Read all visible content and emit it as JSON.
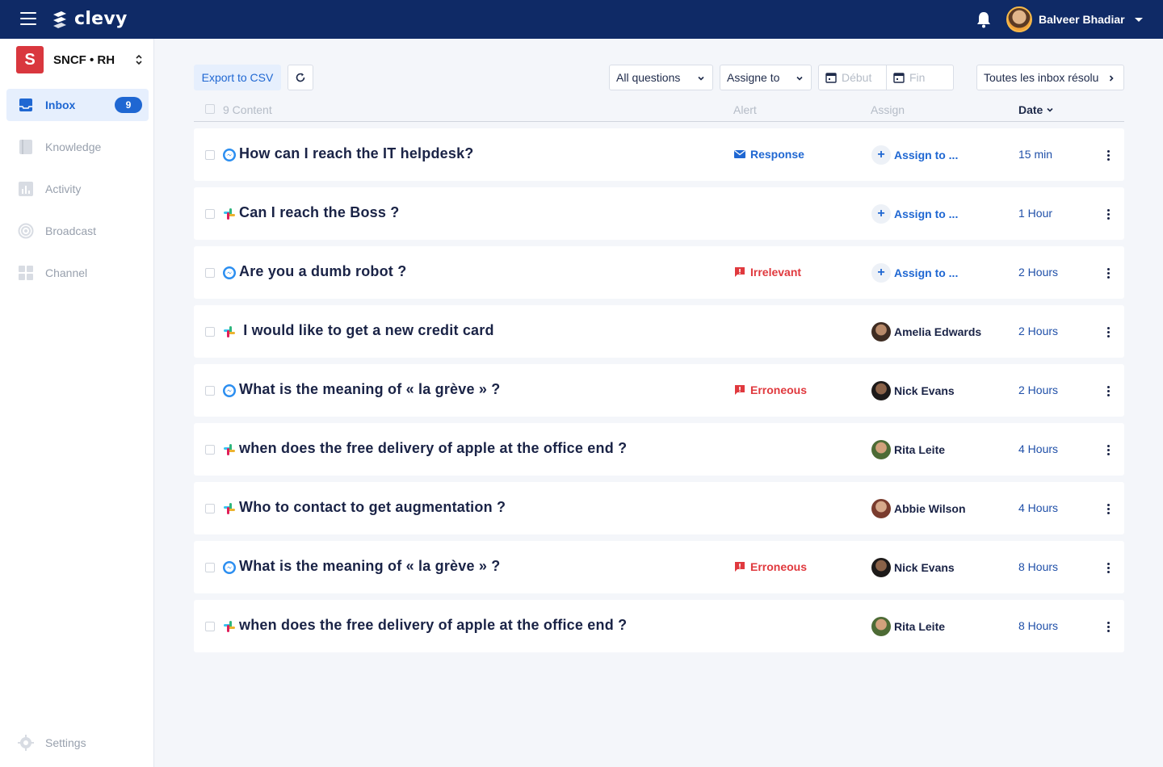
{
  "topbar": {
    "logo_text": "clevy",
    "user_name": "Balveer Bhadiar"
  },
  "sidebar": {
    "org_initial": "S",
    "org_name": "SNCF • RH",
    "items": [
      {
        "label": "Inbox",
        "icon": "inbox-icon",
        "badge": "9",
        "active": true
      },
      {
        "label": "Knowledge",
        "icon": "book-icon"
      },
      {
        "label": "Activity",
        "icon": "bar-chart-icon"
      },
      {
        "label": "Broadcast",
        "icon": "broadcast-icon"
      },
      {
        "label": "Channel",
        "icon": "grid-icon"
      }
    ],
    "settings_label": "Settings"
  },
  "toolbar": {
    "export_label": "Export to CSV",
    "questions_filter": "All questions",
    "assignee_filter": "Assigne to",
    "start_placeholder": "Début",
    "end_placeholder": "Fin",
    "inbox_filter": "Toutes les inbox résolu"
  },
  "header": {
    "content": "9 Content",
    "alert": "Alert",
    "assign": "Assign",
    "date": "Date"
  },
  "colors": {
    "brand": "#0f2a66",
    "accent": "#1f67d2",
    "alert_red": "#e0393e"
  },
  "rows": [
    {
      "channel": "messenger",
      "question": "How can I reach the IT helpdesk?",
      "alert": "Response",
      "alert_type": "response",
      "assign": "Assign to ...",
      "assignee": "",
      "time": "15 min"
    },
    {
      "channel": "slack",
      "question": "Can I reach the Boss ?",
      "alert": "",
      "alert_type": "",
      "assign": "Assign to ...",
      "assignee": "",
      "time": "1 Hour"
    },
    {
      "channel": "messenger",
      "question": "Are you a dumb robot ?",
      "alert": "Irrelevant",
      "alert_type": "flag",
      "assign": "Assign to ...",
      "assignee": "",
      "time": "2 Hours"
    },
    {
      "channel": "slack",
      "question": " I would like to get a new credit card",
      "alert": "",
      "alert_type": "",
      "assign": "",
      "assignee": "Amelia Edwards",
      "time": "2 Hours"
    },
    {
      "channel": "messenger",
      "question": "What is the meaning of « la grève » ?",
      "alert": "Erroneous",
      "alert_type": "flag",
      "assign": "",
      "assignee": "Nick Evans",
      "time": "2 Hours"
    },
    {
      "channel": "slack",
      "question": "when does the free delivery of apple at the office end ?",
      "alert": "",
      "alert_type": "",
      "assign": "",
      "assignee": "Rita Leite",
      "time": "4 Hours"
    },
    {
      "channel": "slack",
      "question": "Who to contact to get augmentation ?",
      "alert": "",
      "alert_type": "",
      "assign": "",
      "assignee": "Abbie Wilson",
      "time": "4 Hours"
    },
    {
      "channel": "messenger",
      "question": "What is the meaning of « la grève » ?",
      "alert": "Erroneous",
      "alert_type": "flag",
      "assign": "",
      "assignee": "Nick Evans",
      "time": "8 Hours"
    },
    {
      "channel": "slack",
      "question": "when does the free delivery of apple at the office end ?",
      "alert": "",
      "alert_type": "",
      "assign": "",
      "assignee": "Rita Leite",
      "time": "8 Hours"
    }
  ]
}
